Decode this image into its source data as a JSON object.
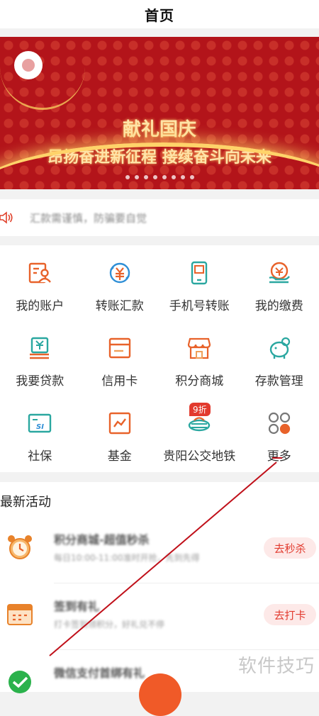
{
  "header": {
    "title": "首页"
  },
  "banner": {
    "line1": "献礼国庆",
    "line2": "昂扬奋进新征程 接续奋斗向未来",
    "dot_count": 8
  },
  "notice": {
    "text": "汇款需谨慎，防骗要自觉"
  },
  "services": [
    [
      {
        "label": "我的账户",
        "icon": "account-icon"
      },
      {
        "label": "转账汇款",
        "icon": "transfer-icon"
      },
      {
        "label": "手机号转账",
        "icon": "phone-transfer-icon"
      },
      {
        "label": "我的缴费",
        "icon": "payment-icon"
      }
    ],
    [
      {
        "label": "我要贷款",
        "icon": "loan-icon"
      },
      {
        "label": "信用卡",
        "icon": "credit-card-icon"
      },
      {
        "label": "积分商城",
        "icon": "points-mall-icon"
      },
      {
        "label": "存款管理",
        "icon": "deposit-icon"
      }
    ],
    [
      {
        "label": "社保",
        "icon": "social-security-icon"
      },
      {
        "label": "基金",
        "icon": "fund-icon"
      },
      {
        "label": "贵阳公交地铁",
        "icon": "metro-icon",
        "badge": "9折"
      },
      {
        "label": "更多",
        "icon": "more-icon"
      }
    ]
  ],
  "activities": {
    "title": "最新活动",
    "items": [
      {
        "name": "积分商城-超值秒杀",
        "desc": "每日10:00-11:00准时开抢，先到先得",
        "button": "去秒杀",
        "icon": "alarm-clock-icon"
      },
      {
        "name": "签到有礼",
        "desc": "打卡签到领积分，好礼兑不停",
        "button": "去打卡",
        "icon": "calendar-icon"
      },
      {
        "name": "微信支付首绑有礼",
        "desc": "",
        "button": "",
        "icon": "check-circle-icon"
      }
    ]
  },
  "watermark": "软件技巧",
  "colors": {
    "accent": "#e8622a",
    "badge": "#e23a2e",
    "teal": "#2aa7a0",
    "blue": "#2f8fd6"
  }
}
